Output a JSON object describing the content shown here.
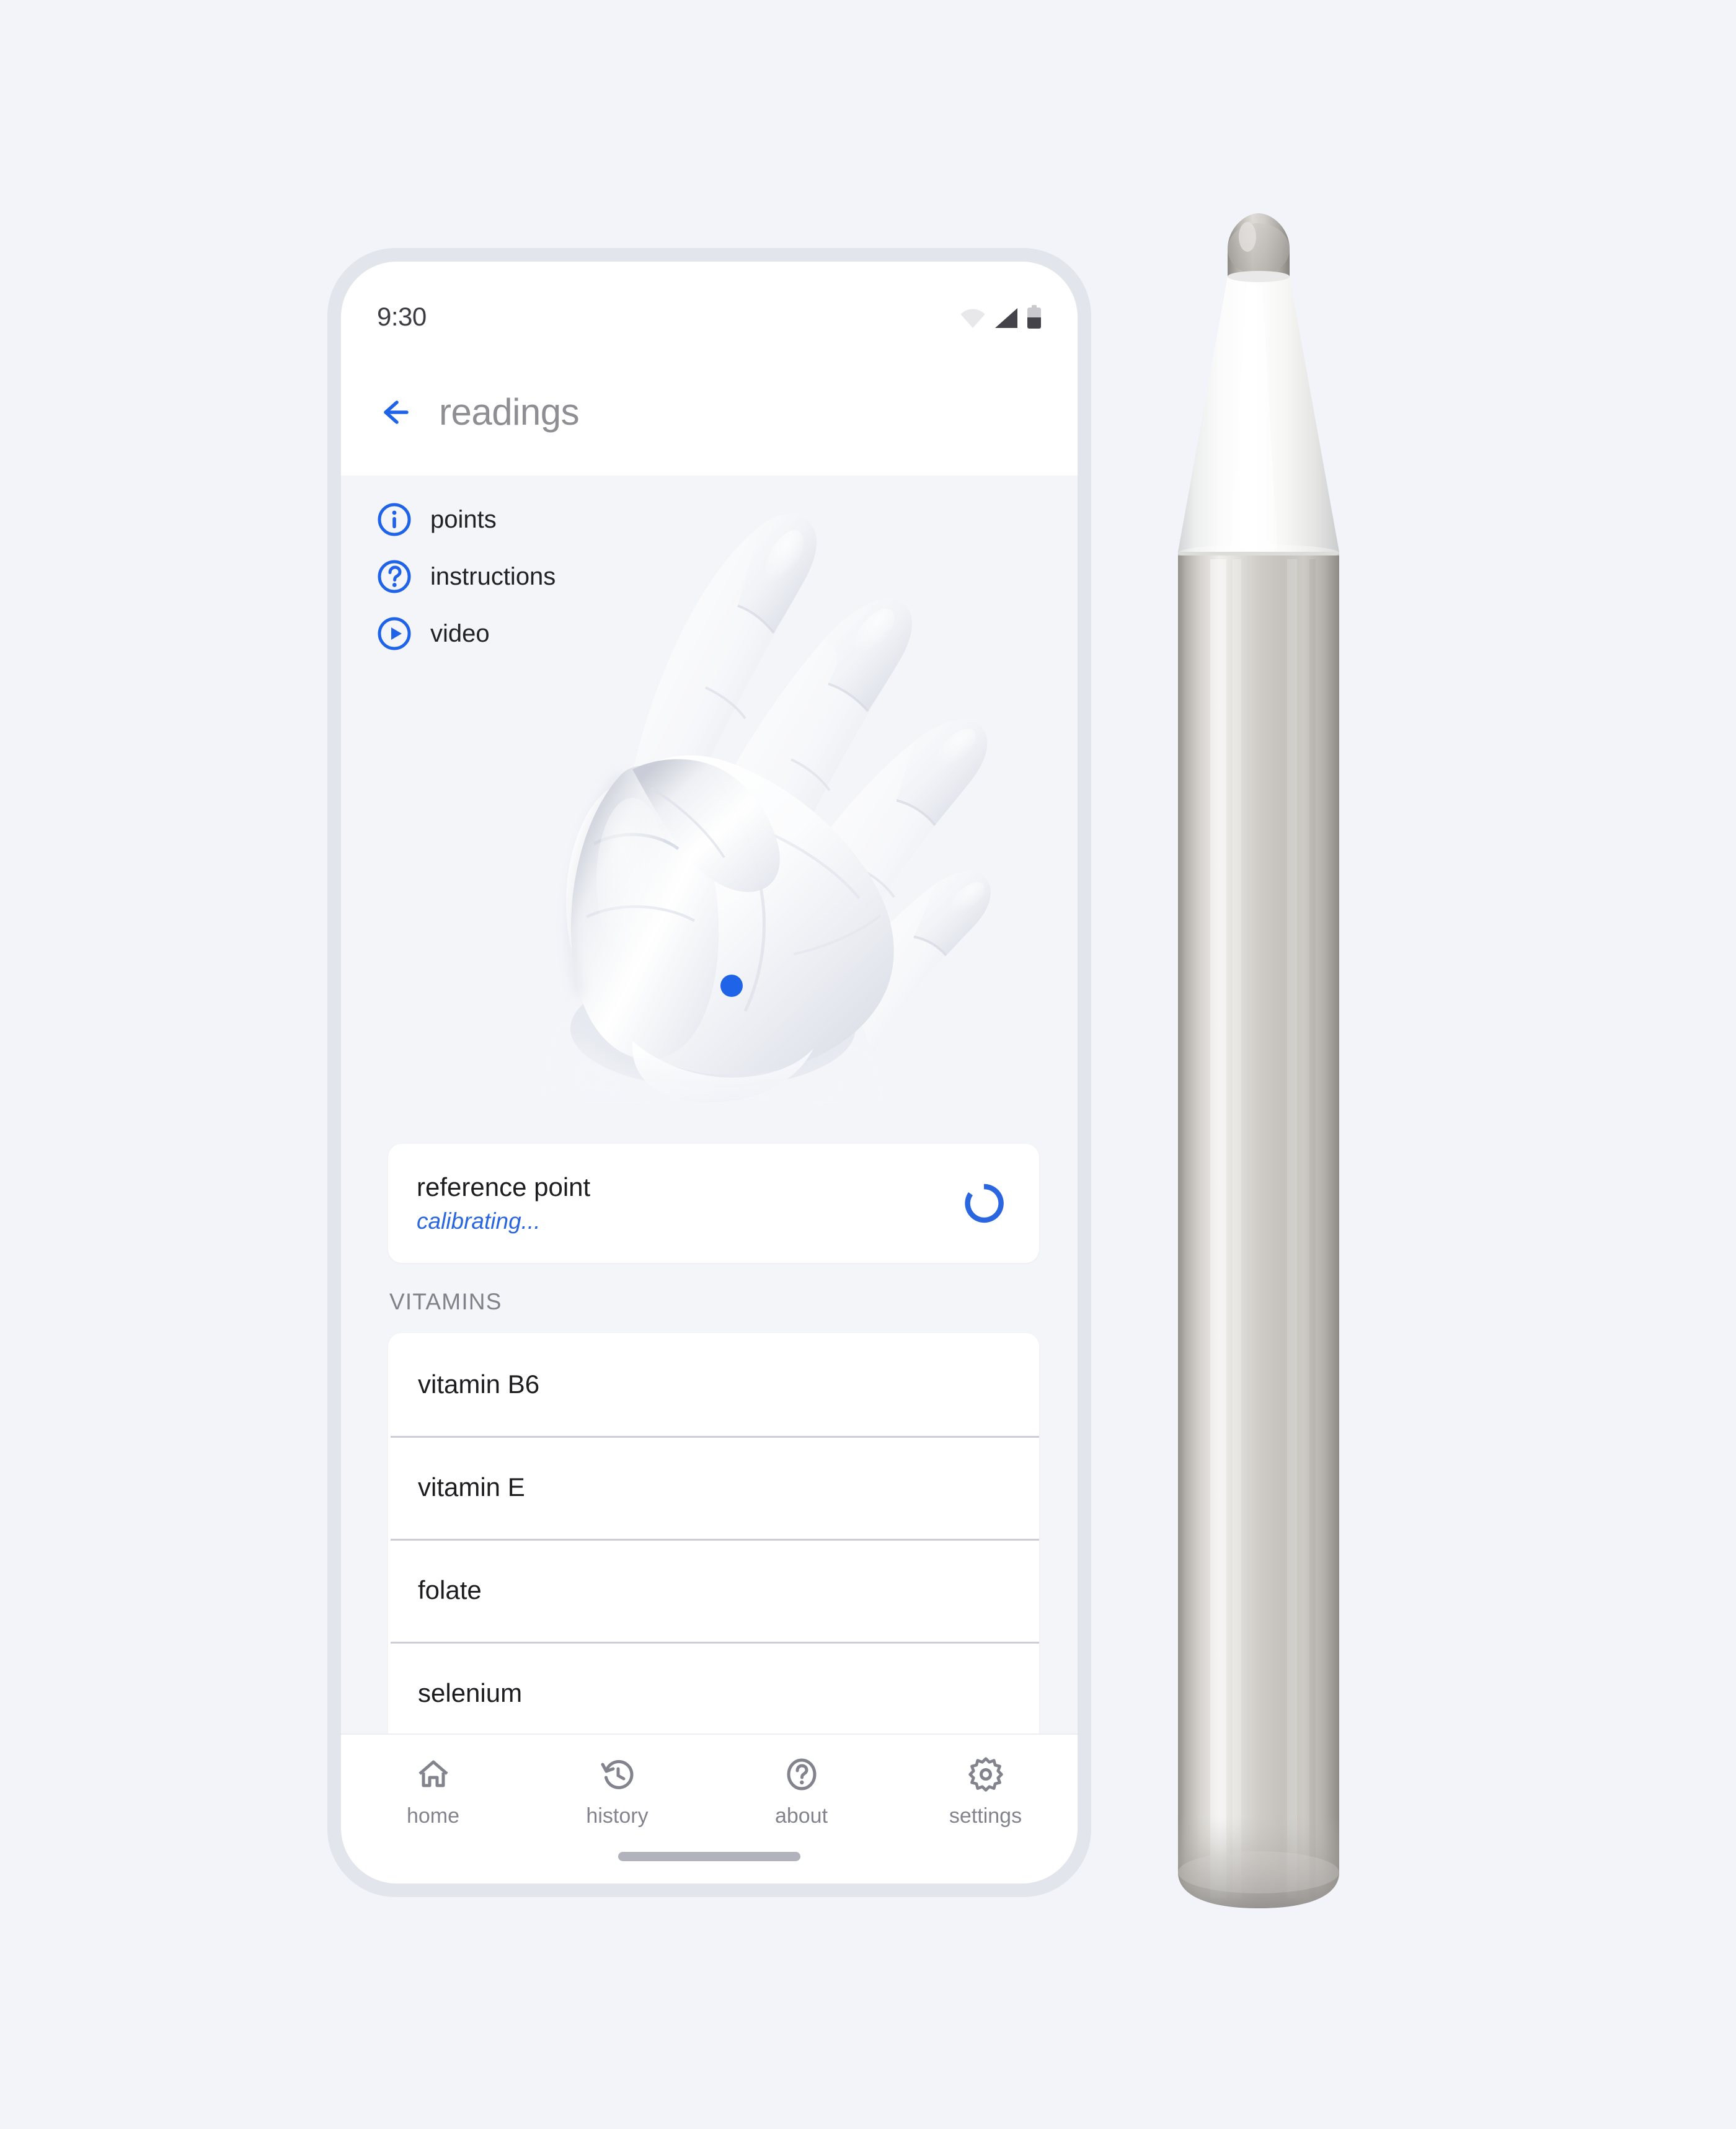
{
  "status_bar": {
    "time": "9:30",
    "icons": [
      "wifi-icon",
      "cellular-signal-icon",
      "battery-icon"
    ]
  },
  "app_bar": {
    "back_icon": "arrow-left-icon",
    "title": "readings"
  },
  "quick_links": [
    {
      "label": "points",
      "icon": "info-circle-icon"
    },
    {
      "label": "instructions",
      "icon": "question-circle-icon"
    },
    {
      "label": "video",
      "icon": "play-circle-icon"
    }
  ],
  "illustration": {
    "name": "hand-diagram",
    "marker": "reference-point-marker",
    "marker_color": "#1f63e8"
  },
  "reference_card": {
    "title": "reference point",
    "status": "calibrating...",
    "spinner": "loading-spinner-icon",
    "accent_color": "#2a66e0"
  },
  "vitamins_section": {
    "header": "VITAMINS",
    "items": [
      {
        "label": "vitamin B6"
      },
      {
        "label": "vitamin E"
      },
      {
        "label": "folate"
      },
      {
        "label": "selenium"
      }
    ]
  },
  "bottom_nav": [
    {
      "label": "home",
      "icon": "home-icon"
    },
    {
      "label": "history",
      "icon": "history-clock-icon"
    },
    {
      "label": "about",
      "icon": "question-circle-icon"
    },
    {
      "label": "settings",
      "icon": "gear-icon"
    }
  ],
  "device": {
    "stylus": "stylus-pen"
  },
  "theme": {
    "background": "#f2f4f9",
    "screen_background": "#f4f5f9",
    "surface": "#ffffff",
    "bezel": "#e3e5ed",
    "accent_blue": "#1f63e8",
    "text_primary": "#1d1d20",
    "text_secondary": "#83838e"
  }
}
